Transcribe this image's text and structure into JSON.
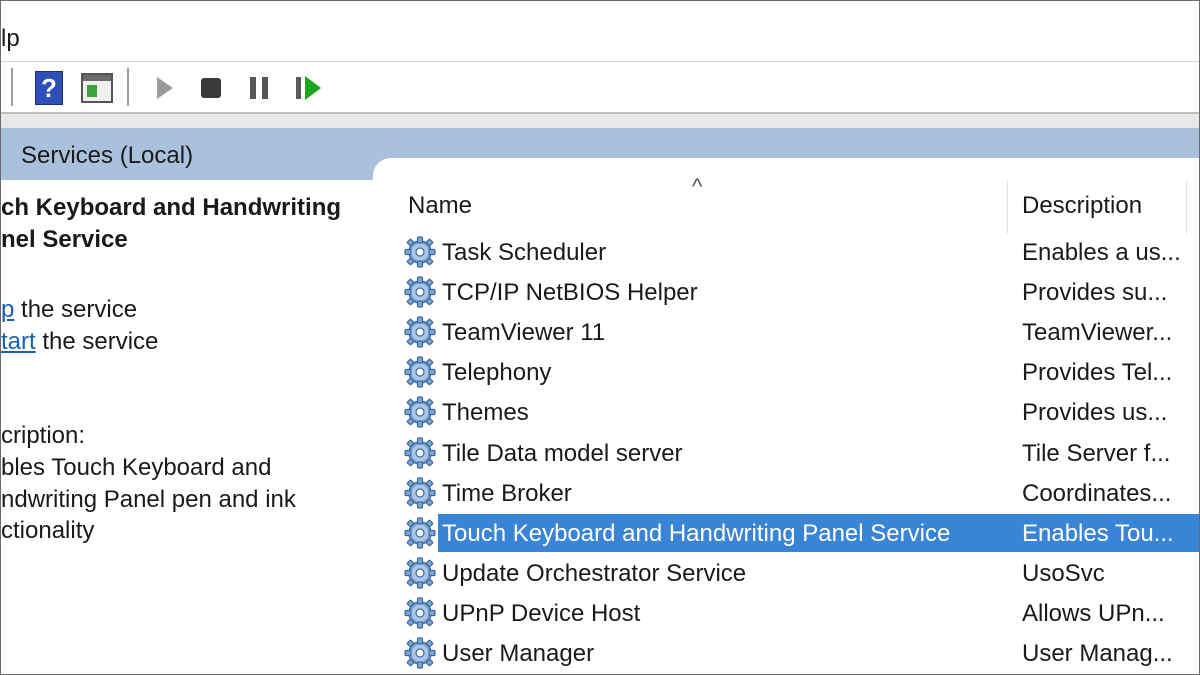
{
  "menu": {
    "help_partial": "lp"
  },
  "toolbar": {
    "help_icon": "help-icon",
    "pane_icon": "show-hide-pane-icon",
    "start_icon": "play-icon",
    "stop_icon": "stop-icon",
    "pause_icon": "pause-icon",
    "resume_icon": "resume-icon",
    "help_glyph": "?"
  },
  "header": {
    "title": "Services (Local)"
  },
  "left_pane": {
    "service_title": "ch Keyboard and Handwriting\nnel Service",
    "actions": [
      {
        "link": "p",
        "rest": " the service"
      },
      {
        "link": "tart",
        "rest": " the service"
      }
    ],
    "description_label": "cription:",
    "description_text": "bles Touch Keyboard and\nndwriting Panel pen and ink\nctionality"
  },
  "list": {
    "sort_glyph": "^",
    "columns": {
      "name": "Name",
      "description": "Description"
    },
    "rows": [
      {
        "name": "Task Scheduler",
        "description": "Enables a us..."
      },
      {
        "name": "TCP/IP NetBIOS Helper",
        "description": "Provides su..."
      },
      {
        "name": "TeamViewer 11",
        "description": "TeamViewer..."
      },
      {
        "name": "Telephony",
        "description": "Provides Tel..."
      },
      {
        "name": "Themes",
        "description": "Provides us..."
      },
      {
        "name": "Tile Data model server",
        "description": "Tile Server f..."
      },
      {
        "name": "Time Broker",
        "description": "Coordinates..."
      },
      {
        "name": "Touch Keyboard and Handwriting Panel Service",
        "description": "Enables Tou...",
        "selected": true
      },
      {
        "name": "Update Orchestrator Service",
        "description": "UsoSvc"
      },
      {
        "name": "UPnP Device Host",
        "description": "Allows UPn..."
      },
      {
        "name": "User Manager",
        "description": "User Manag..."
      }
    ]
  },
  "colors": {
    "header_bg": "#a9c1dc",
    "selection_bg": "#3a84d6",
    "link": "#1a5fb4",
    "resume_green": "#1ea51e"
  }
}
